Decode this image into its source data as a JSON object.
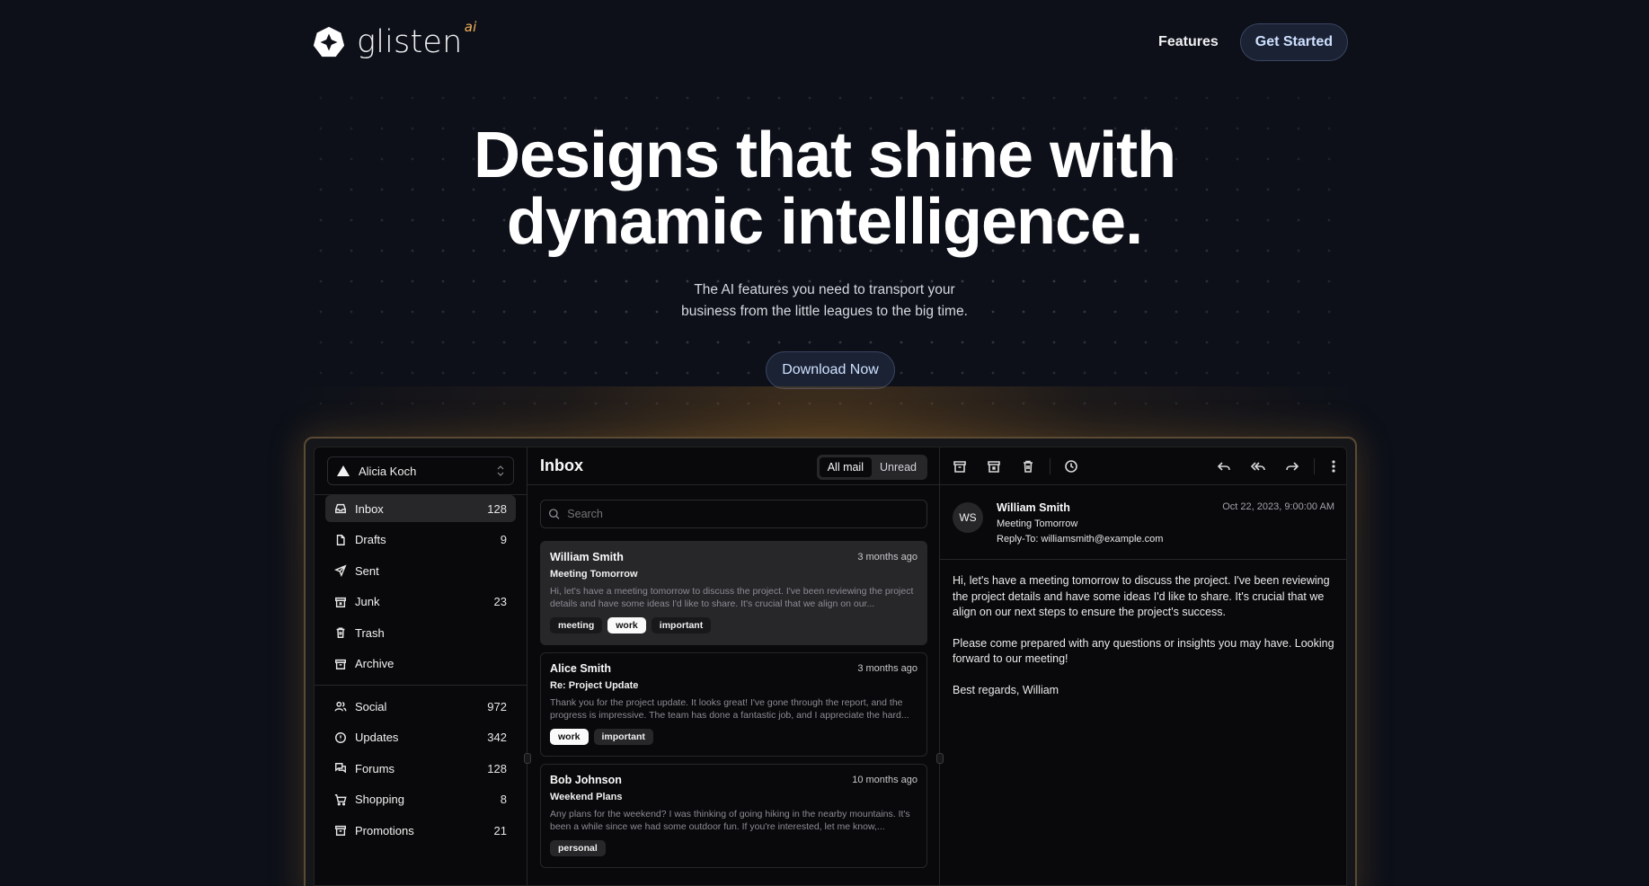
{
  "nav": {
    "brand": "glisten",
    "brand_sup": "ai",
    "features": "Features",
    "cta": "Get Started"
  },
  "hero": {
    "title_line1": "Designs that shine with",
    "title_line2": "dynamic intelligence.",
    "sub_line1": "The AI features you need to transport your",
    "sub_line2": "business from the little leagues to the big time.",
    "download": "Download Now"
  },
  "app": {
    "account": "Alicia Koch",
    "folders": [
      {
        "label": "Inbox",
        "count": "128",
        "icon": "inbox-icon"
      },
      {
        "label": "Drafts",
        "count": "9",
        "icon": "file-icon"
      },
      {
        "label": "Sent",
        "count": "",
        "icon": "send-icon"
      },
      {
        "label": "Junk",
        "count": "23",
        "icon": "archive-x-icon"
      },
      {
        "label": "Trash",
        "count": "",
        "icon": "trash-icon"
      },
      {
        "label": "Archive",
        "count": "",
        "icon": "archive-icon"
      }
    ],
    "categories": [
      {
        "label": "Social",
        "count": "972",
        "icon": "users-icon"
      },
      {
        "label": "Updates",
        "count": "342",
        "icon": "alert-circle-icon"
      },
      {
        "label": "Forums",
        "count": "128",
        "icon": "messages-icon"
      },
      {
        "label": "Shopping",
        "count": "8",
        "icon": "cart-icon"
      },
      {
        "label": "Promotions",
        "count": "21",
        "icon": "archive-icon"
      }
    ],
    "list": {
      "title": "Inbox",
      "tab_all": "All mail",
      "tab_unread": "Unread",
      "search_placeholder": "Search",
      "mails": [
        {
          "from": "William Smith",
          "when": "3 months ago",
          "subject": "Meeting Tomorrow",
          "preview": "Hi, let's have a meeting tomorrow to discuss the project. I've been reviewing the project details and have some ideas I'd like to share. It's crucial that we align on our...",
          "tags": [
            "meeting",
            "work",
            "important"
          ]
        },
        {
          "from": "Alice Smith",
          "when": "3 months ago",
          "subject": "Re: Project Update",
          "preview": "Thank you for the project update. It looks great! I've gone through the report, and the progress is impressive. The team has done a fantastic job, and I appreciate the hard...",
          "tags": [
            "work",
            "important"
          ]
        },
        {
          "from": "Bob Johnson",
          "when": "10 months ago",
          "subject": "Weekend Plans",
          "preview": "Any plans for the weekend? I was thinking of going hiking in the nearby mountains. It's been a while since we had some outdoor fun. If you're interested, let me know,...",
          "tags": [
            "personal"
          ]
        }
      ]
    },
    "detail": {
      "initials": "WS",
      "name": "William Smith",
      "subject": "Meeting Tomorrow",
      "reply_to": "Reply-To: williamsmith@example.com",
      "date": "Oct 22, 2023, 9:00:00 AM",
      "body_p1": "Hi, let's have a meeting tomorrow to discuss the project. I've been reviewing the project details and have some ideas I'd like to share. It's crucial that we align on our next steps to ensure the project's success.",
      "body_p2": "Please come prepared with any questions or insights you may have. Looking forward to our meeting!",
      "body_p3": "Best regards, William"
    }
  },
  "colors": {
    "background": "#0d1019",
    "accent": "#f0b35a",
    "button_bg": "#1a2234",
    "button_text": "#cfe0ff"
  }
}
